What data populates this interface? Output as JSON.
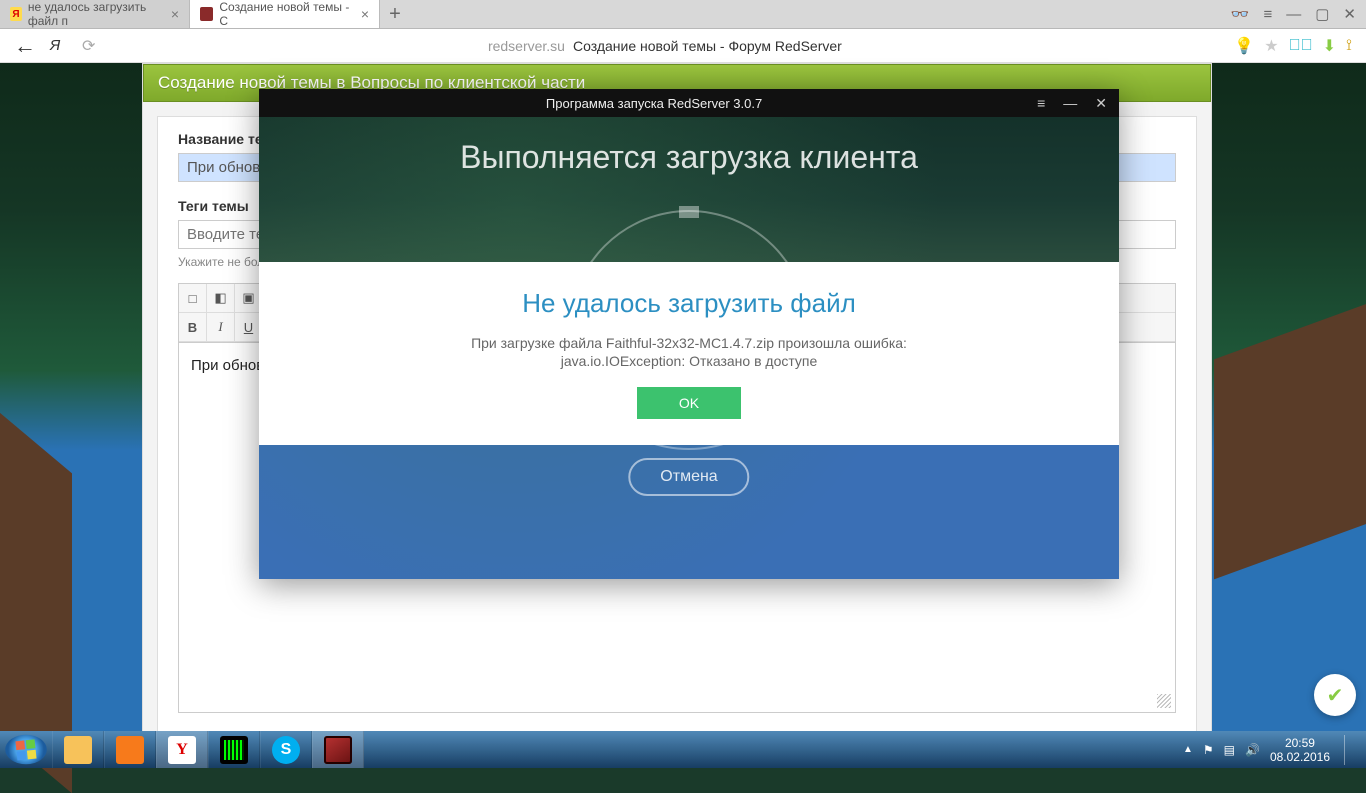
{
  "browser": {
    "tabs": [
      {
        "title": "не удалось загрузить файл п",
        "fav_kind": "y",
        "active": false
      },
      {
        "title": "Создание новой темы - С",
        "fav_kind": "r",
        "active": true
      }
    ],
    "url_host": "redserver.su",
    "url_title": "Создание новой темы - Форум RedServer"
  },
  "forum": {
    "breadcrumb": "Создание новой темы в Вопросы по клиентской части",
    "title_label": "Название темы",
    "title_value": "При обнов",
    "tags_label": "Теги темы",
    "tags_placeholder": "Вводите теги рзд",
    "tags_hint": "Укажите не более",
    "editor_text": "При обновле"
  },
  "launcher": {
    "window_title": "Программа запуска RedServer 3.0.7",
    "banner": "Выполняется загрузка клиента",
    "cancel": "Отмена",
    "error": {
      "title": "Не удалось загрузить файл",
      "line1": "При загрузке файла Faithful-32x32-MC1.4.7.zip произошла ошибка:",
      "line2": "java.io.IOException: Отказано в доступе",
      "ok": "OK"
    }
  },
  "taskbar": {
    "time": "20:59",
    "date": "08.02.2016"
  }
}
